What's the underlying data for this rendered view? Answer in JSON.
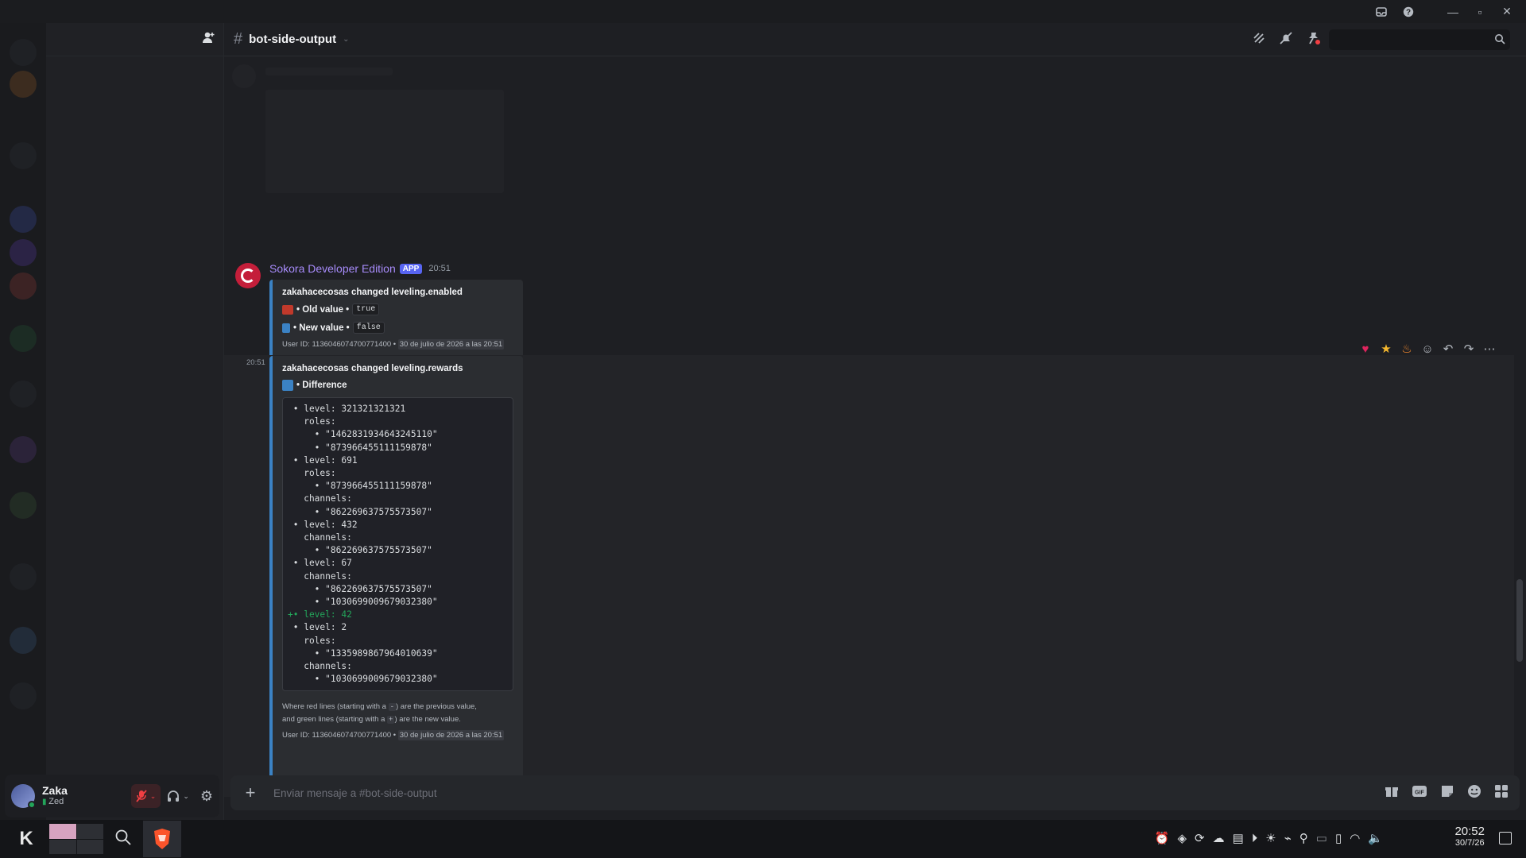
{
  "channel": {
    "name": "bot-side-output"
  },
  "search": {
    "placeholder": ""
  },
  "user": {
    "name": "Zaka",
    "status": "Zed"
  },
  "message1": {
    "author": "Sokora Developer Edition",
    "tag": "APP",
    "time": "20:51",
    "title": "zakahacecosas changed leveling.enabled",
    "old_label": "• Old value •",
    "old_value": "true",
    "new_label": "• New value •",
    "new_value": "false",
    "footer_user": "User ID: 1136046074700771400 •",
    "footer_date": "30 de julio de 2026 a las 20:51"
  },
  "message2": {
    "time": "20:51",
    "title": "zakahacecosas changed leveling.rewards",
    "diff_label": "• Difference",
    "code_lines": [
      {
        "text": " • level: 321321321321",
        "added": false
      },
      {
        "text": "   roles:",
        "added": false
      },
      {
        "text": "     • \"1462831934643245110\"",
        "added": false
      },
      {
        "text": "     • \"873966455111159878\"",
        "added": false
      },
      {
        "text": " • level: 691",
        "added": false
      },
      {
        "text": "   roles:",
        "added": false
      },
      {
        "text": "     • \"873966455111159878\"",
        "added": false
      },
      {
        "text": "   channels:",
        "added": false
      },
      {
        "text": "     • \"862269637575573507\"",
        "added": false
      },
      {
        "text": " • level: 432",
        "added": false
      },
      {
        "text": "   channels:",
        "added": false
      },
      {
        "text": "     • \"862269637575573507\"",
        "added": false
      },
      {
        "text": " • level: 67",
        "added": false
      },
      {
        "text": "   channels:",
        "added": false
      },
      {
        "text": "     • \"862269637575573507\"",
        "added": false
      },
      {
        "text": "     • \"1030699009679032380\"",
        "added": false
      },
      {
        "text": "+• level: 42",
        "added": true
      },
      {
        "text": " • level: 2",
        "added": false
      },
      {
        "text": "   roles:",
        "added": false
      },
      {
        "text": "     • \"1335989867964010639\"",
        "added": false
      },
      {
        "text": "   channels:",
        "added": false
      },
      {
        "text": "     • \"1030699009679032380\"",
        "added": false
      }
    ],
    "note_a": "Where red lines (starting with a",
    "note_a_key": "-",
    "note_b": ") are the previous value,",
    "note_c": "and green lines (starting with a",
    "note_c_key": "+",
    "note_d": ") are the new value.",
    "footer_user": "User ID: 1136046074700771400 •",
    "footer_date": "30 de julio de 2026 a las 20:51"
  },
  "composer": {
    "placeholder": "Enviar mensaje a #bot-side-output"
  },
  "clock": {
    "time": "20:52",
    "date": "30/7/26"
  },
  "colors": {
    "accent": "#5865f2",
    "author": "#a78bfa",
    "embed_border": "#3b82c4",
    "added": "#23a55a"
  }
}
